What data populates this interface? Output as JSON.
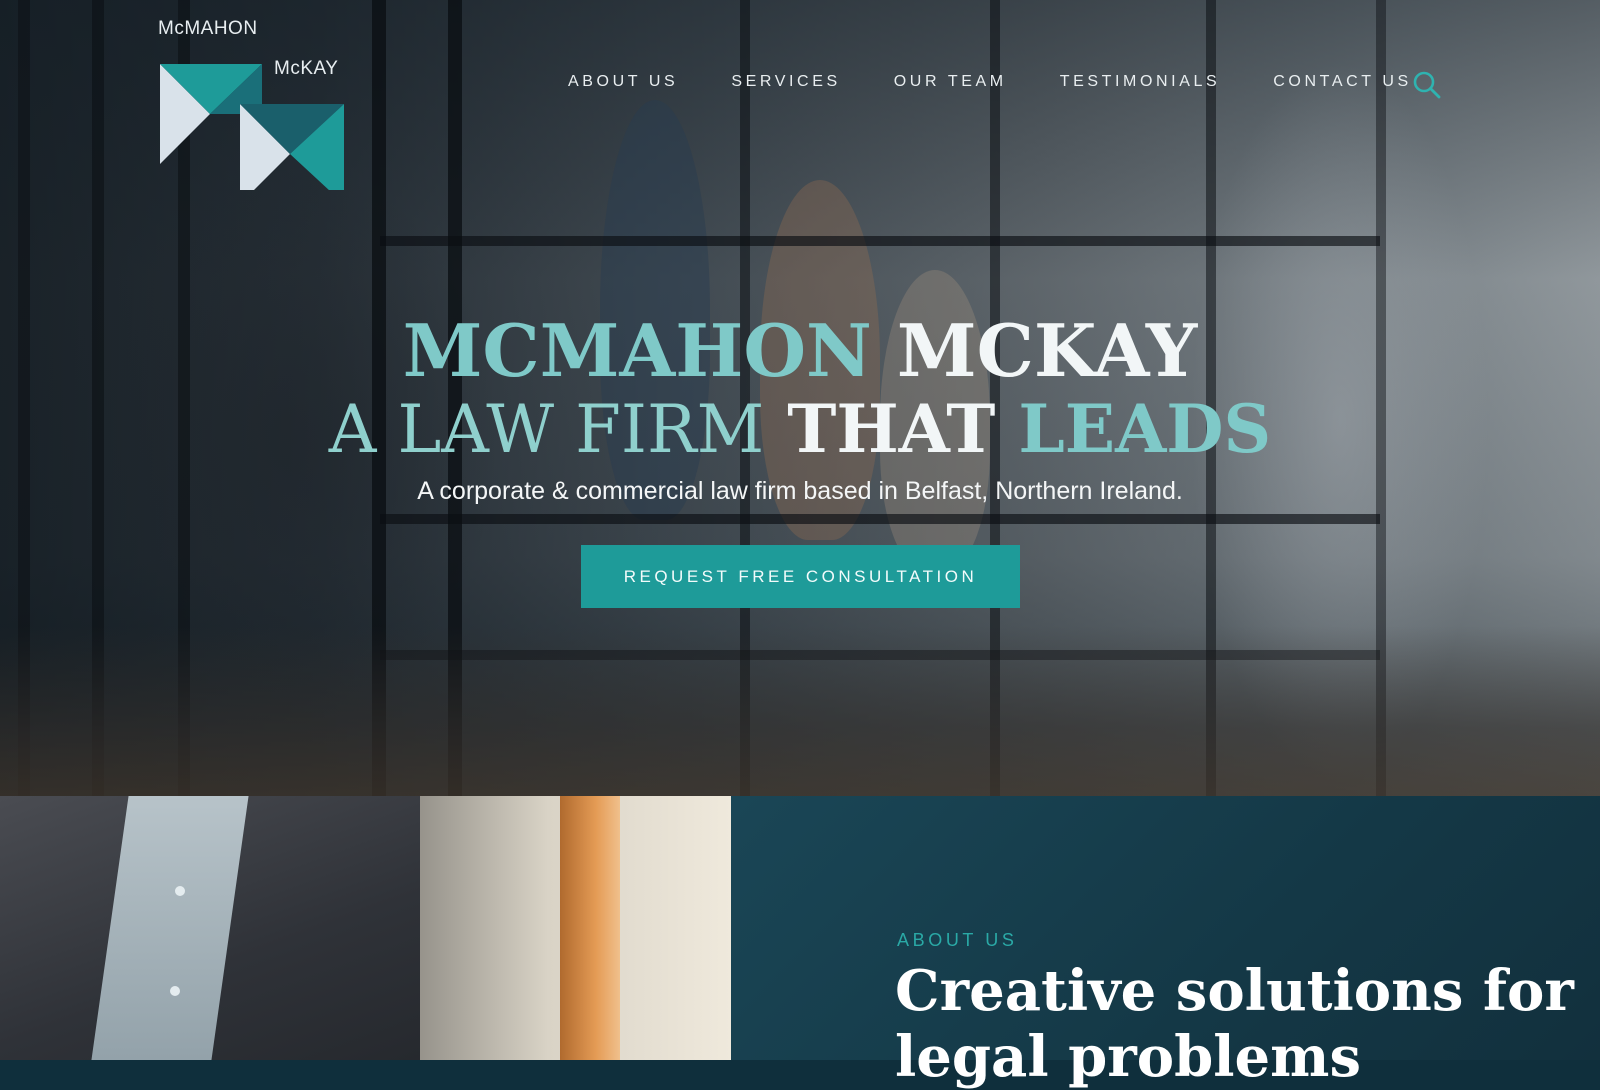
{
  "brand": {
    "line1": "McMAHON",
    "line2": "McKAY",
    "accent": "#1e9b99",
    "light_teal": "#7fc9c8"
  },
  "nav": {
    "items": [
      "ABOUT US",
      "SERVICES",
      "OUR TEAM",
      "TESTIMONIALS",
      "CONTACT US"
    ],
    "search_icon": "search-icon"
  },
  "hero": {
    "title_line1_part1": "MCMAHON",
    "title_line1_part2": "MCKAY",
    "title_line2_part1": "A LAW FIRM",
    "title_line2_part2": "THAT",
    "title_line2_part3": "LEADS",
    "subtitle": "A corporate & commercial law firm based in Belfast, Northern Ireland.",
    "cta_label": "REQUEST FREE CONSULTATION"
  },
  "about": {
    "label": "ABOUT US",
    "heading": "Creative solutions for legal problems"
  }
}
